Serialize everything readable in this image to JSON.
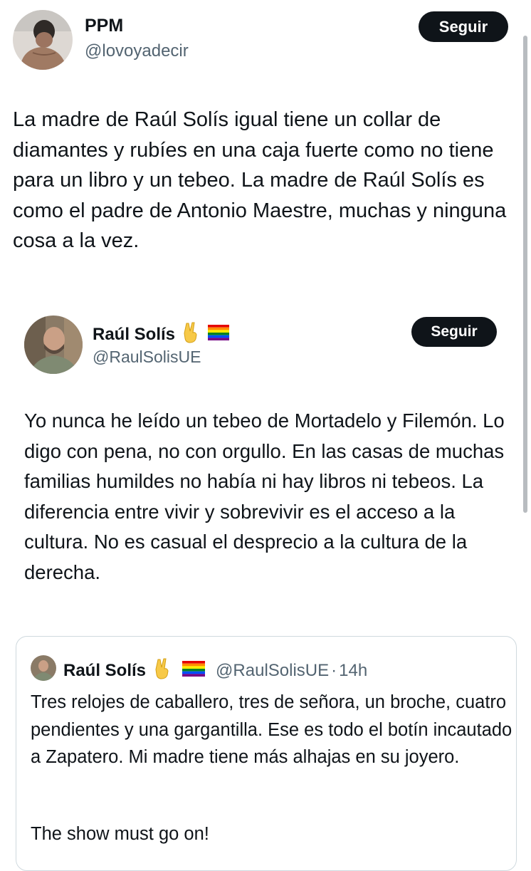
{
  "main_tweet": {
    "author_name": "PPM",
    "handle": "@lovoyadecir",
    "follow_label": "Seguir",
    "text": "La madre de Raúl Solís igual tiene un collar de diamantes y rubíes en una caja fuerte como no tiene para un libro y un tebeo. La madre de Raúl Solís es como el padre de Antonio Maestre, muchas y ninguna cosa a la vez."
  },
  "quoted_tweet": {
    "author_name": "Raúl Solís",
    "handle": "@RaulSolisUE",
    "follow_label": "Seguir",
    "text": "Yo nunca he leído un tebeo de Mortadelo y Filemón. Lo digo con pena, no con orgullo. En las casas de muchas familias humildes no había ni hay libros ni tebeos. La diferencia entre vivir y sobrevivir es el acceso a la cultura. No es casual el desprecio a la cultura de la derecha."
  },
  "nested_quote": {
    "author_name": "Raúl Solís",
    "handle": "@RaulSolisUE",
    "separator": "·",
    "time": "14h",
    "text": "Tres relojes de caballero, tres de señora, un broche, cuatro pendientes y una gargantilla. Ese es todo el botín incautado a Zapatero. Mi madre tiene más alhajas en su joyero.",
    "text2": "The show must go on!"
  },
  "icons": [
    "victory-hand-icon",
    "rainbow-flag-icon"
  ]
}
